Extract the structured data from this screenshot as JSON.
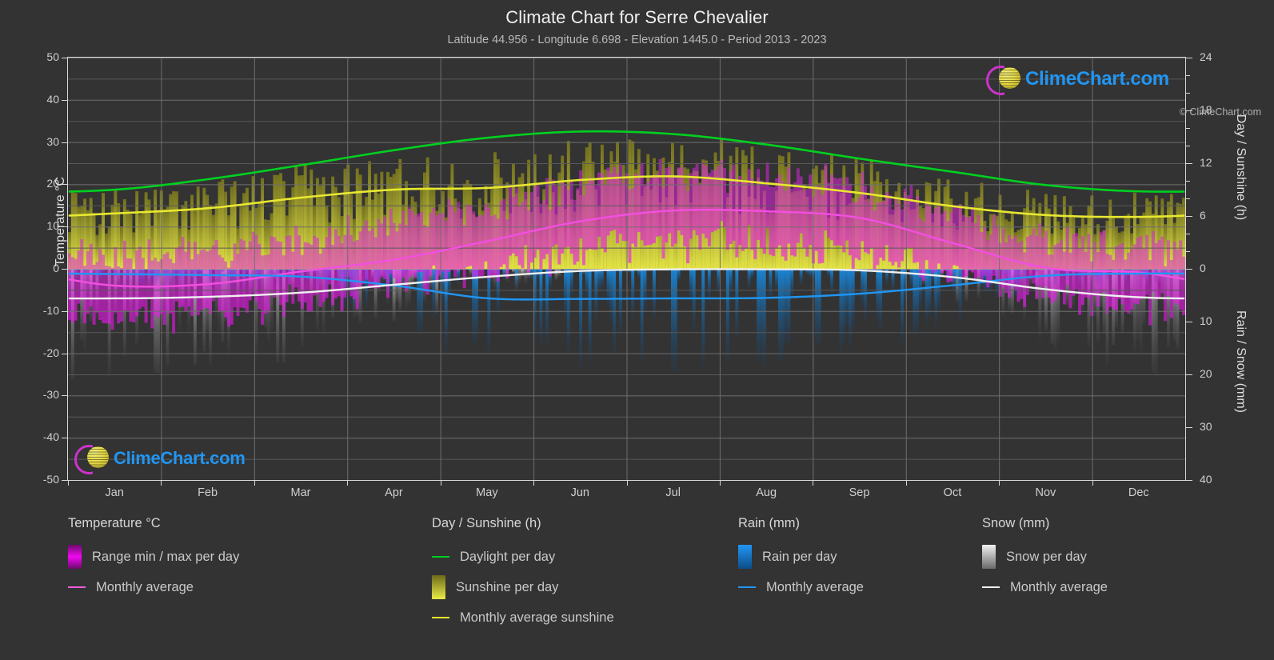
{
  "header": {
    "title": "Climate Chart for Serre Chevalier",
    "subtitle": "Latitude 44.956 - Longitude 6.698 - Elevation 1445.0 - Period 2013 - 2023"
  },
  "watermark": {
    "text": "ClimeChart.com",
    "logo_icon": "climechart-logo-icon"
  },
  "axes": {
    "left_title": "Temperature °C",
    "right_title_top": "Day / Sunshine (h)",
    "right_title_bottom": "Rain / Snow (mm)",
    "left_ticks": [
      "50",
      "40",
      "30",
      "20",
      "10",
      "0",
      "-10",
      "-20",
      "-30",
      "-40",
      "-50"
    ],
    "right_ticks_top": [
      "24",
      "18",
      "12",
      "6",
      "0"
    ],
    "right_ticks_bottom": [
      "10",
      "20",
      "30",
      "40"
    ],
    "x_ticks": [
      "Jan",
      "Feb",
      "Mar",
      "Apr",
      "May",
      "Jun",
      "Jul",
      "Aug",
      "Sep",
      "Oct",
      "Nov",
      "Dec"
    ]
  },
  "legend": {
    "groups": [
      {
        "title": "Temperature °C",
        "items": [
          {
            "label": "Range min / max per day",
            "marker": "swatch",
            "color": "#e800e8",
            "swatch_name": "temperature-range-swatch"
          },
          {
            "label": "Monthly average",
            "marker": "line",
            "color": "#ef5fd8",
            "swatch_name": "temperature-average-line-swatch"
          }
        ]
      },
      {
        "title": "Day / Sunshine (h)",
        "items": [
          {
            "label": "Daylight per day",
            "marker": "line",
            "color": "#00d020",
            "swatch_name": "daylight-line-swatch"
          },
          {
            "label": "Sunshine per day",
            "marker": "swatch",
            "color": "#e8e830",
            "swatch_name": "sunshine-range-swatch"
          },
          {
            "label": "Monthly average sunshine",
            "marker": "line",
            "color": "#e8e830",
            "swatch_name": "sunshine-average-line-swatch"
          }
        ]
      },
      {
        "title": "Rain (mm)",
        "items": [
          {
            "label": "Rain per day",
            "marker": "swatch",
            "color": "#1282d8",
            "swatch_name": "rain-range-swatch"
          },
          {
            "label": "Monthly average",
            "marker": "line",
            "color": "#2196f3",
            "swatch_name": "rain-average-line-swatch"
          }
        ]
      },
      {
        "title": "Snow (mm)",
        "items": [
          {
            "label": "Snow per day",
            "marker": "swatch",
            "color": "#e0e0e0",
            "swatch_name": "snow-range-swatch"
          },
          {
            "label": "Monthly average",
            "marker": "line",
            "color": "#f0f0f0",
            "swatch_name": "snow-average-line-swatch"
          }
        ]
      }
    ],
    "copyright": "© ClimeChart.com"
  },
  "colors": {
    "background": "#333333",
    "daylight": "#00d020",
    "sunshine": "#e8e830",
    "temperature": "#e800e8",
    "temperature_avg": "#f24fe0",
    "rain": "#1282d8",
    "rain_avg": "#2196f3",
    "snow": "#d8d8d8",
    "snow_avg": "#f0f0f0",
    "grid": "#5c5c5c",
    "text": "#c8c8c8"
  },
  "chart_data": {
    "type": "line",
    "title": "Climate Chart for Serre Chevalier",
    "subtitle": "Latitude 44.956 - Longitude 6.698 - Elevation 1445.0 - Period 2013 - 2023",
    "xlabel": "",
    "ylabel": "Temperature °C",
    "ylim": [
      -50,
      50
    ],
    "y2lim_top_hours": [
      0,
      24
    ],
    "y2lim_bottom_mm": [
      0,
      40
    ],
    "grid": true,
    "legend_position": "below",
    "categories": [
      "Jan",
      "Feb",
      "Mar",
      "Apr",
      "May",
      "Jun",
      "Jul",
      "Aug",
      "Sep",
      "Oct",
      "Nov",
      "Dec"
    ],
    "series": [
      {
        "name": "Daylight per day",
        "unit": "h",
        "axis": "right-top",
        "color": "#00d020",
        "values": [
          9.0,
          10.2,
          11.8,
          13.5,
          14.9,
          15.6,
          15.3,
          14.1,
          12.5,
          11.0,
          9.5,
          8.8
        ]
      },
      {
        "name": "Monthly average sunshine",
        "unit": "h",
        "axis": "right-top",
        "color": "#e8e830",
        "values": [
          6.3,
          6.9,
          8.1,
          9.0,
          9.2,
          10.1,
          10.5,
          9.7,
          8.6,
          7.1,
          6.1,
          5.9
        ]
      },
      {
        "name": "Temperature monthly average",
        "unit": "°C",
        "axis": "left",
        "color": "#f24fe0",
        "values": [
          -4.0,
          -3.6,
          -0.6,
          2.2,
          6.6,
          11.3,
          13.8,
          13.6,
          12.0,
          6.0,
          0.2,
          -0.9
        ]
      },
      {
        "name": "Temperature range max per day",
        "unit": "°C",
        "axis": "left",
        "color": "#e800e8",
        "values": [
          3.5,
          4.0,
          7.0,
          10.0,
          14.5,
          19.5,
          22.0,
          21.5,
          19.0,
          13.0,
          7.0,
          5.5
        ]
      },
      {
        "name": "Temperature range min per day",
        "unit": "°C",
        "axis": "left",
        "color": "#e800e8",
        "values": [
          -11.0,
          -10.5,
          -7.5,
          -4.5,
          -0.5,
          3.5,
          6.0,
          6.0,
          4.0,
          -1.0,
          -6.0,
          -8.5
        ]
      },
      {
        "name": "Rain monthly average",
        "unit": "mm",
        "axis": "right-bottom",
        "color": "#2196f3",
        "values": [
          1.0,
          1.2,
          1.5,
          3.2,
          5.6,
          5.7,
          5.6,
          5.5,
          4.7,
          3.1,
          1.3,
          0.9
        ]
      },
      {
        "name": "Snow monthly average",
        "unit": "mm",
        "axis": "right-bottom",
        "color": "#f0f0f0",
        "values": [
          5.6,
          5.3,
          4.5,
          3.0,
          1.5,
          0.4,
          0.1,
          0.1,
          0.3,
          1.6,
          3.9,
          5.4
        ]
      }
    ]
  }
}
